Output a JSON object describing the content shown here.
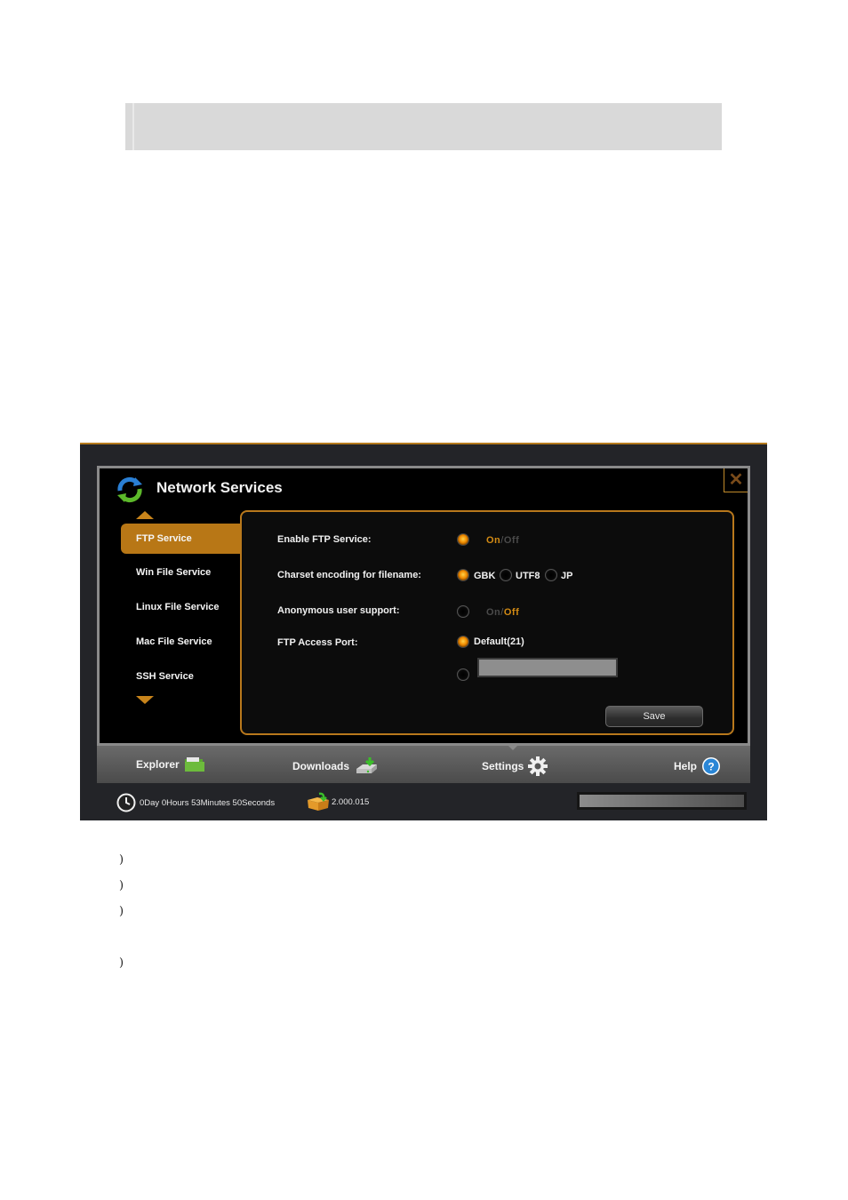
{
  "app": {
    "dialog_title": "Network Services",
    "close_icon": "close-icon",
    "sidebar": {
      "items": [
        {
          "label": "FTP Service",
          "active": true
        },
        {
          "label": "Win File Service",
          "active": false
        },
        {
          "label": "Linux File Service",
          "active": false
        },
        {
          "label": "Mac File Service",
          "active": false
        },
        {
          "label": "SSH Service",
          "active": false
        }
      ]
    },
    "form": {
      "enable_ftp": {
        "label": "Enable FTP Service:",
        "on": "On",
        "sep": "/",
        "off": "Off",
        "value": "On"
      },
      "charset": {
        "label": "Charset encoding for filename:",
        "options": [
          "GBK",
          "UTF8",
          "JP"
        ],
        "selected": "GBK"
      },
      "anonymous": {
        "label": "Anonymous user support:",
        "on": "On",
        "sep": "/",
        "off": "Off",
        "value": "Off"
      },
      "port": {
        "label": "FTP Access Port:",
        "default_option": "Default(21)",
        "custom_value": "",
        "selected": "default"
      },
      "save_label": "Save"
    },
    "toolbar": {
      "items": [
        {
          "label": "Explorer",
          "icon": "folder-icon"
        },
        {
          "label": "Downloads",
          "icon": "download-drive-icon"
        },
        {
          "label": "Settings",
          "icon": "gear-icon"
        },
        {
          "label": "Help",
          "icon": "help-icon"
        }
      ]
    },
    "status": {
      "uptime": "0Day 0Hours 53Minutes 50Seconds",
      "version": "2.000.015",
      "progress_fraction": 1.0
    },
    "colors": {
      "accent": "#b87716",
      "panel_border": "#b8781c"
    }
  },
  "document": {
    "bullets": [
      ")",
      ")",
      ")",
      ")"
    ]
  }
}
